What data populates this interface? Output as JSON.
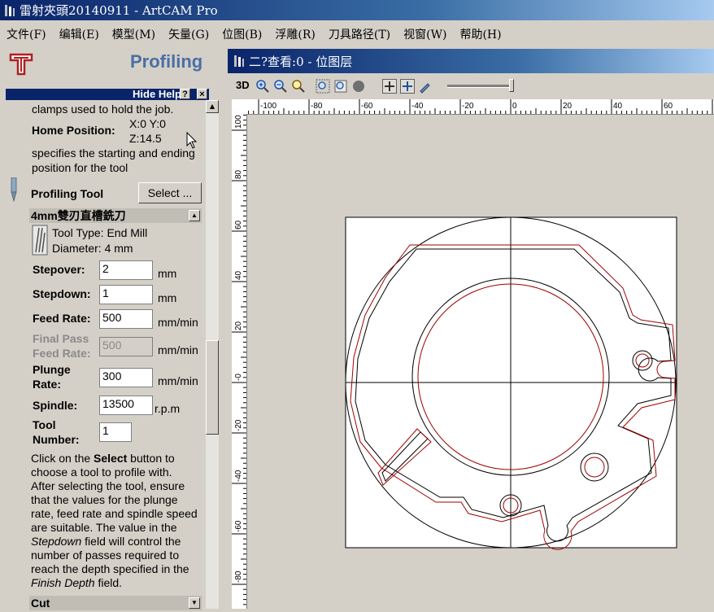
{
  "window": {
    "title": "雷射夾頭20140911 - ArtCAM Pro"
  },
  "menu": [
    {
      "label": "文件(F)"
    },
    {
      "label": "编辑(E)"
    },
    {
      "label": "模型(M)"
    },
    {
      "label": "矢量(G)"
    },
    {
      "label": "位图(B)"
    },
    {
      "label": "浮雕(R)"
    },
    {
      "label": "刀具路径(T)"
    },
    {
      "label": "视窗(W)"
    },
    {
      "label": "帮助(H)"
    }
  ],
  "panel": {
    "title": "Profiling",
    "help": {
      "label": "Hide Help",
      "help_btn": "?",
      "close_btn": "×"
    },
    "clamps_text": "clamps used to hold the job.",
    "home_position": {
      "label": "Home Position:",
      "xy": "X:0 Y:0",
      "z": "Z:14.5"
    },
    "home_desc_1": "specifies the starting and ending",
    "home_desc_2": "position for the tool",
    "profiling_tool_label": "Profiling Tool",
    "select_button": "Select ...",
    "tool": {
      "name": "4mm雙刃直槽銑刀",
      "type": "Tool Type: End Mill",
      "diameter": "Diameter:  4 mm"
    },
    "fields": {
      "stepover": {
        "label": "Stepover:",
        "value": "2",
        "unit": "mm"
      },
      "stepdown": {
        "label": "Stepdown:",
        "value": "1",
        "unit": "mm"
      },
      "feed_rate": {
        "label": "Feed Rate:",
        "value": "500",
        "unit": "mm/min"
      },
      "final_pass": {
        "label1": "Final Pass",
        "label2": "Feed Rate:",
        "value": "500",
        "unit": "mm/min"
      },
      "plunge_rate": {
        "label1": "Plunge",
        "label2": "Rate:",
        "value": "300",
        "unit": "mm/min"
      },
      "spindle": {
        "label": "Spindle:",
        "value": "13500",
        "unit": "r.p.m"
      },
      "tool_number": {
        "label1": "Tool",
        "label2": "Number:",
        "value": "1"
      }
    },
    "help_text": {
      "l1a": "Click on the ",
      "l1b": "Select",
      "l1c": " button to",
      "l2": "choose a tool to profile with.",
      "l3": "After selecting the tool, ensure",
      "l4": "that the values for the plunge",
      "l5": "rate, feed rate and spindle speed",
      "l6": "are suitable. The value in the",
      "l7a": "Stepdown",
      "l7b": " field will control the",
      "l8": "number of passes required to",
      "l9": "reach the depth specified in the",
      "l10a": "Finish Depth",
      "l10b": " field."
    },
    "cut_section": "Cut"
  },
  "view": {
    "title": "二?查看:0 - 位图层",
    "toolbar_3d": "3D"
  },
  "ruler": {
    "x_labels": [
      "-100",
      "-80",
      "-60",
      "-40",
      "-20",
      "0",
      "20",
      "40",
      "60"
    ],
    "y_labels": [
      "100",
      "80",
      "60",
      "40",
      "20",
      "-0",
      "-20",
      "-40",
      "-60",
      "-80"
    ]
  },
  "colors": {
    "outline": "#000000",
    "toolpath": "#a00000",
    "title_start": "#0a246a",
    "title_end": "#a6caf0",
    "panel_title": "#4a6fa5"
  }
}
